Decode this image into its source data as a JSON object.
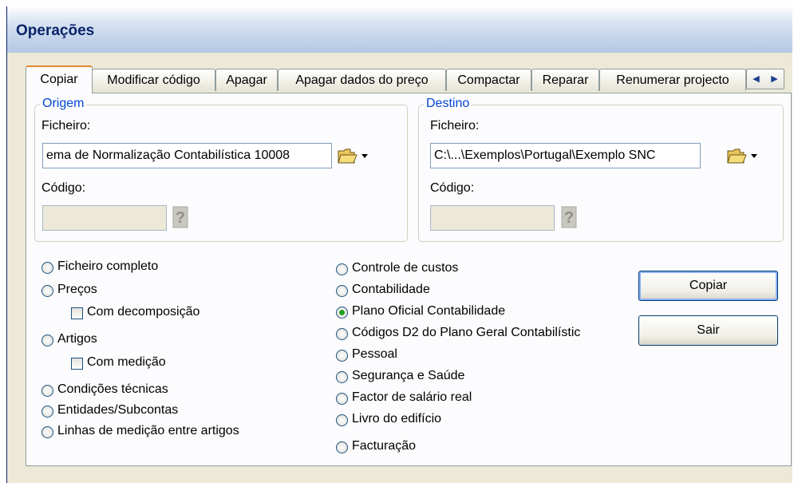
{
  "window": {
    "title": "Operações"
  },
  "tabs": [
    {
      "label": "Copiar",
      "active": true
    },
    {
      "label": "Modificar código"
    },
    {
      "label": "Apagar"
    },
    {
      "label": "Apagar dados do preço"
    },
    {
      "label": "Compactar"
    },
    {
      "label": "Reparar"
    },
    {
      "label": "Renumerar projecto"
    }
  ],
  "tab_scroll": {
    "left": "◀",
    "right": "▶"
  },
  "origem": {
    "title": "Origem",
    "ficheiro_label": "Ficheiro:",
    "ficheiro_value": "ema de Normalização Contabilística 10008",
    "codigo_label": "Código:",
    "codigo_value": ""
  },
  "destino": {
    "title": "Destino",
    "ficheiro_label": "Ficheiro:",
    "ficheiro_value": "C:\\...\\Exemplos\\Portugal\\Exemplo SNC",
    "codigo_label": "Código:",
    "codigo_value": ""
  },
  "options_left": {
    "ficheiro_completo": "Ficheiro completo",
    "precos": "Preços",
    "com_decomposicao": "Com decomposição",
    "artigos": "Artigos",
    "com_medicao": "Com medição",
    "condicoes_tecnicas": "Condições técnicas",
    "entidades": "Entidades/Subcontas",
    "linhas_medicao": "Linhas de medição entre artigos"
  },
  "options_right": [
    {
      "label": "Controle de custos",
      "checked": false
    },
    {
      "label": "Contabilidade",
      "checked": false
    },
    {
      "label": "Plano Oficial Contabilidade",
      "checked": true
    },
    {
      "label": "Códigos D2 do Plano Geral Contabilístic",
      "checked": false
    },
    {
      "label": "Pessoal",
      "checked": false
    },
    {
      "label": "Segurança e Saúde",
      "checked": false
    },
    {
      "label": "Factor de salário real",
      "checked": false
    },
    {
      "label": "Livro do edifício",
      "checked": false
    },
    {
      "label": "Facturação",
      "checked": false
    }
  ],
  "buttons": {
    "copiar": "Copiar",
    "sair": "Sair"
  },
  "icons": {
    "folder": "open-folder-icon",
    "dropdown": "dropdown-arrow-icon",
    "help": "question-mark-icon"
  }
}
